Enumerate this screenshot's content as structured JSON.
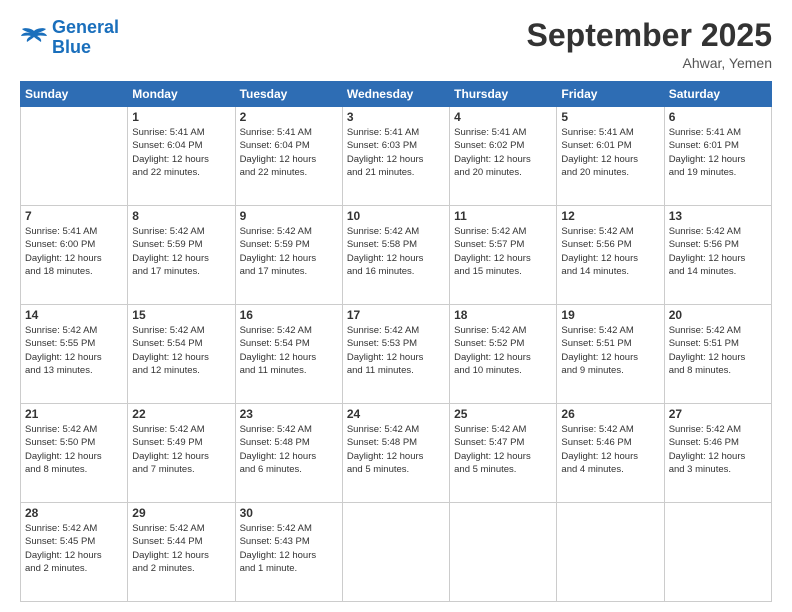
{
  "logo": {
    "text_general": "General",
    "text_blue": "Blue"
  },
  "header": {
    "month": "September 2025",
    "location": "Ahwar, Yemen"
  },
  "weekdays": [
    "Sunday",
    "Monday",
    "Tuesday",
    "Wednesday",
    "Thursday",
    "Friday",
    "Saturday"
  ],
  "weeks": [
    [
      {
        "day": "",
        "info": ""
      },
      {
        "day": "1",
        "info": "Sunrise: 5:41 AM\nSunset: 6:04 PM\nDaylight: 12 hours\nand 22 minutes."
      },
      {
        "day": "2",
        "info": "Sunrise: 5:41 AM\nSunset: 6:04 PM\nDaylight: 12 hours\nand 22 minutes."
      },
      {
        "day": "3",
        "info": "Sunrise: 5:41 AM\nSunset: 6:03 PM\nDaylight: 12 hours\nand 21 minutes."
      },
      {
        "day": "4",
        "info": "Sunrise: 5:41 AM\nSunset: 6:02 PM\nDaylight: 12 hours\nand 20 minutes."
      },
      {
        "day": "5",
        "info": "Sunrise: 5:41 AM\nSunset: 6:01 PM\nDaylight: 12 hours\nand 20 minutes."
      },
      {
        "day": "6",
        "info": "Sunrise: 5:41 AM\nSunset: 6:01 PM\nDaylight: 12 hours\nand 19 minutes."
      }
    ],
    [
      {
        "day": "7",
        "info": "Sunrise: 5:41 AM\nSunset: 6:00 PM\nDaylight: 12 hours\nand 18 minutes."
      },
      {
        "day": "8",
        "info": "Sunrise: 5:42 AM\nSunset: 5:59 PM\nDaylight: 12 hours\nand 17 minutes."
      },
      {
        "day": "9",
        "info": "Sunrise: 5:42 AM\nSunset: 5:59 PM\nDaylight: 12 hours\nand 17 minutes."
      },
      {
        "day": "10",
        "info": "Sunrise: 5:42 AM\nSunset: 5:58 PM\nDaylight: 12 hours\nand 16 minutes."
      },
      {
        "day": "11",
        "info": "Sunrise: 5:42 AM\nSunset: 5:57 PM\nDaylight: 12 hours\nand 15 minutes."
      },
      {
        "day": "12",
        "info": "Sunrise: 5:42 AM\nSunset: 5:56 PM\nDaylight: 12 hours\nand 14 minutes."
      },
      {
        "day": "13",
        "info": "Sunrise: 5:42 AM\nSunset: 5:56 PM\nDaylight: 12 hours\nand 14 minutes."
      }
    ],
    [
      {
        "day": "14",
        "info": "Sunrise: 5:42 AM\nSunset: 5:55 PM\nDaylight: 12 hours\nand 13 minutes."
      },
      {
        "day": "15",
        "info": "Sunrise: 5:42 AM\nSunset: 5:54 PM\nDaylight: 12 hours\nand 12 minutes."
      },
      {
        "day": "16",
        "info": "Sunrise: 5:42 AM\nSunset: 5:54 PM\nDaylight: 12 hours\nand 11 minutes."
      },
      {
        "day": "17",
        "info": "Sunrise: 5:42 AM\nSunset: 5:53 PM\nDaylight: 12 hours\nand 11 minutes."
      },
      {
        "day": "18",
        "info": "Sunrise: 5:42 AM\nSunset: 5:52 PM\nDaylight: 12 hours\nand 10 minutes."
      },
      {
        "day": "19",
        "info": "Sunrise: 5:42 AM\nSunset: 5:51 PM\nDaylight: 12 hours\nand 9 minutes."
      },
      {
        "day": "20",
        "info": "Sunrise: 5:42 AM\nSunset: 5:51 PM\nDaylight: 12 hours\nand 8 minutes."
      }
    ],
    [
      {
        "day": "21",
        "info": "Sunrise: 5:42 AM\nSunset: 5:50 PM\nDaylight: 12 hours\nand 8 minutes."
      },
      {
        "day": "22",
        "info": "Sunrise: 5:42 AM\nSunset: 5:49 PM\nDaylight: 12 hours\nand 7 minutes."
      },
      {
        "day": "23",
        "info": "Sunrise: 5:42 AM\nSunset: 5:48 PM\nDaylight: 12 hours\nand 6 minutes."
      },
      {
        "day": "24",
        "info": "Sunrise: 5:42 AM\nSunset: 5:48 PM\nDaylight: 12 hours\nand 5 minutes."
      },
      {
        "day": "25",
        "info": "Sunrise: 5:42 AM\nSunset: 5:47 PM\nDaylight: 12 hours\nand 5 minutes."
      },
      {
        "day": "26",
        "info": "Sunrise: 5:42 AM\nSunset: 5:46 PM\nDaylight: 12 hours\nand 4 minutes."
      },
      {
        "day": "27",
        "info": "Sunrise: 5:42 AM\nSunset: 5:46 PM\nDaylight: 12 hours\nand 3 minutes."
      }
    ],
    [
      {
        "day": "28",
        "info": "Sunrise: 5:42 AM\nSunset: 5:45 PM\nDaylight: 12 hours\nand 2 minutes."
      },
      {
        "day": "29",
        "info": "Sunrise: 5:42 AM\nSunset: 5:44 PM\nDaylight: 12 hours\nand 2 minutes."
      },
      {
        "day": "30",
        "info": "Sunrise: 5:42 AM\nSunset: 5:43 PM\nDaylight: 12 hours\nand 1 minute."
      },
      {
        "day": "",
        "info": ""
      },
      {
        "day": "",
        "info": ""
      },
      {
        "day": "",
        "info": ""
      },
      {
        "day": "",
        "info": ""
      }
    ]
  ]
}
